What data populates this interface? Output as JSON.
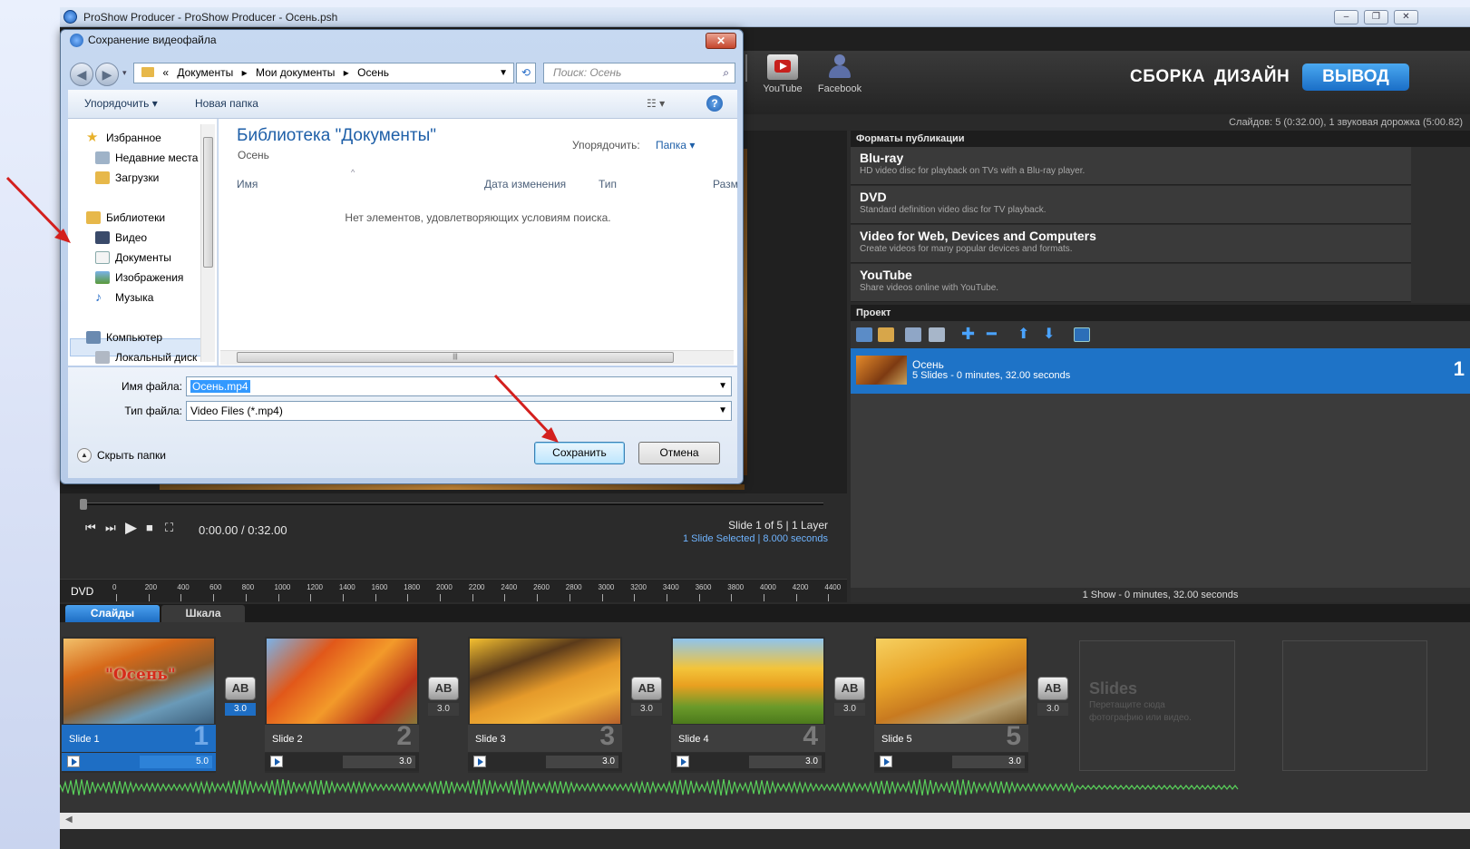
{
  "app": {
    "title": "ProShow Producer - ProShow Producer - Осень.psh",
    "toolbar": [
      {
        "label": "YouTube",
        "icon": "youtube-icon"
      },
      {
        "label": "Facebook",
        "icon": "facebook-icon"
      }
    ],
    "modes": {
      "build": "СБОРКА",
      "design": "ДИЗАЙН",
      "output": "ВЫВОД"
    },
    "status": "Слайдов: 5 (0:32.00), 1 звуковая дорожка (5:00.82)"
  },
  "publishing": {
    "header": "Форматы публикации",
    "formats": [
      {
        "title": "Blu-ray",
        "desc": "HD video disc for playback on TVs with a Blu-ray player."
      },
      {
        "title": "DVD",
        "desc": "Standard definition video disc for TV playback."
      },
      {
        "title": "Video for Web, Devices and Computers",
        "desc": "Create videos for many popular devices and formats."
      },
      {
        "title": "YouTube",
        "desc": "Share videos online with YouTube."
      }
    ]
  },
  "project": {
    "header": "Проект",
    "item": {
      "name": "Осень",
      "summary": "5 Slides - 0 minutes, 32.00 seconds",
      "index": "1"
    },
    "footer": "1 Show - 0 minutes, 32.00 seconds"
  },
  "player": {
    "timecode": "0:00.00 / 0:32.00",
    "slide_info": "Slide 1 of 5  |  1 Layer",
    "selection_info": "1 Slide Selected  |  8.000 seconds"
  },
  "ruler": {
    "label": "DVD",
    "ticks": [
      "0",
      "200",
      "400",
      "600",
      "800",
      "1000",
      "1200",
      "1400",
      "1600",
      "1800",
      "2000",
      "2200",
      "2400",
      "2600",
      "2800",
      "3000",
      "3200",
      "3400",
      "3600",
      "3800",
      "4000",
      "4200",
      "4400"
    ]
  },
  "tabs": {
    "slides": "Слайды",
    "timeline": "Шкала"
  },
  "slides": [
    {
      "label": "Slide 1",
      "num": "1",
      "duration": "5.0",
      "transition": "3.0",
      "overlay": "\"Осень\""
    },
    {
      "label": "Slide 2",
      "num": "2",
      "duration": "3.0",
      "transition": "3.0"
    },
    {
      "label": "Slide 3",
      "num": "3",
      "duration": "3.0",
      "transition": "3.0"
    },
    {
      "label": "Slide 4",
      "num": "4",
      "duration": "3.0",
      "transition": "3.0"
    },
    {
      "label": "Slide 5",
      "num": "5",
      "duration": "3.0",
      "transition": "3.0"
    }
  ],
  "transition_icon_text": "AB",
  "slides_placeholder": {
    "title": "Slides",
    "hint": "Перетащите сюда фотографию или видео."
  },
  "dialog": {
    "title": "Сохранение видеофайла",
    "path": {
      "prefix": "«",
      "parts": [
        "Документы",
        "Мои документы",
        "Осень"
      ]
    },
    "search_placeholder": "Поиск: Осень",
    "organize": "Упорядочить ▾",
    "new_folder": "Новая папка",
    "nav": {
      "favorites": "Избранное",
      "recent": "Недавние места",
      "downloads": "Загрузки",
      "libraries": "Библиотеки",
      "video": "Видео",
      "documents": "Документы",
      "images": "Изображения",
      "music": "Музыка",
      "computer": "Компьютер",
      "local_disk": "Локальный диск"
    },
    "library_title": "Библиотека \"Документы\"",
    "library_subtitle": "Осень",
    "arrange_label": "Упорядочить:",
    "arrange_value": "Папка ▾",
    "columns": {
      "name": "Имя",
      "date": "Дата изменения",
      "type": "Тип",
      "size": "Разм"
    },
    "empty_message": "Нет элементов, удовлетворяющих условиям поиска.",
    "filename_label": "Имя файла:",
    "filename_value": "Осень.mp4",
    "filetype_label": "Тип файла:",
    "filetype_value": "Video Files (*.mp4)",
    "hide_folders": "Скрыть папки",
    "save": "Сохранить",
    "cancel": "Отмена"
  },
  "colors": {
    "accent": "#1e6ec4",
    "dark_bg": "#2b2b2b",
    "dialog_frame": "#c7d9f1",
    "arrow": "#d3201e"
  }
}
